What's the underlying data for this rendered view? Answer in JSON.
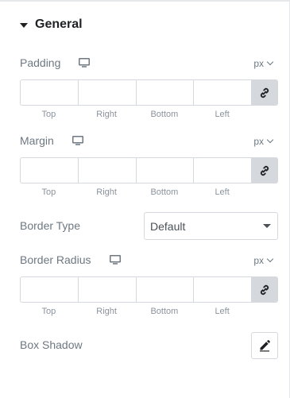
{
  "section": {
    "title": "General"
  },
  "padding": {
    "label": "Padding",
    "unit": "px",
    "inputs": [
      "",
      "",
      "",
      ""
    ],
    "sides": [
      "Top",
      "Right",
      "Bottom",
      "Left"
    ]
  },
  "margin": {
    "label": "Margin",
    "unit": "px",
    "inputs": [
      "",
      "",
      "",
      ""
    ],
    "sides": [
      "Top",
      "Right",
      "Bottom",
      "Left"
    ]
  },
  "border_type": {
    "label": "Border Type",
    "value": "Default"
  },
  "border_radius": {
    "label": "Border Radius",
    "unit": "px",
    "inputs": [
      "",
      "",
      "",
      ""
    ],
    "sides": [
      "Top",
      "Right",
      "Bottom",
      "Left"
    ]
  },
  "box_shadow": {
    "label": "Box Shadow"
  },
  "icons": {
    "section_toggle": "caret-down-icon",
    "responsive": "desktop-icon",
    "link_values": "link-icon",
    "edit": "pencil-icon"
  },
  "colors": {
    "heading": "#1f2124",
    "label": "#6d7882",
    "border": "#d5d8dc",
    "link_button_bg": "#d5d8dc"
  }
}
